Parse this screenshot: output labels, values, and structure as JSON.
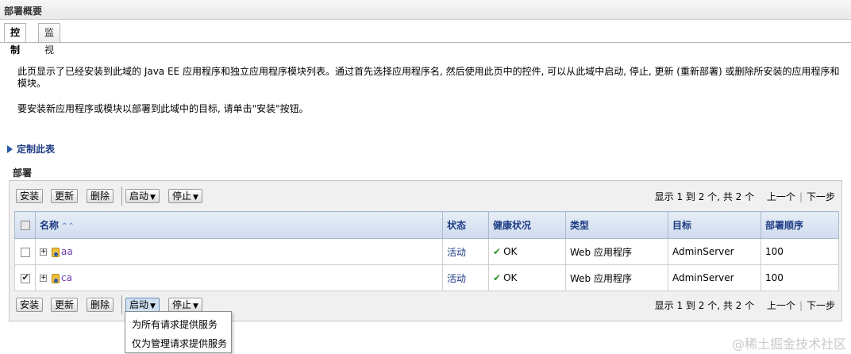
{
  "header": {
    "title": "部署概要"
  },
  "tabs": [
    {
      "label": "控制",
      "active": true
    },
    {
      "label": "监视",
      "active": false
    }
  ],
  "description": {
    "line1": "此页显示了已经安装到此域的 Java EE 应用程序和独立应用程序模块列表。通过首先选择应用程序名, 然后使用此页中的控件, 可以从此域中启动, 停止, 更新 (重新部署) 或删除所安装的应用程序和模块。",
    "line2": "要安装新应用程序或模块以部署到此域中的目标, 请单击\"安装\"按钮。"
  },
  "customize": {
    "label": "定制此表"
  },
  "section": {
    "title": "部署"
  },
  "toolbar": {
    "install": "安装",
    "update": "更新",
    "delete": "删除",
    "start": "启动",
    "stop": "停止"
  },
  "pager": {
    "summary": "显示 1 到 2 个, 共 2 个",
    "prev": "上一个",
    "next": "下一步"
  },
  "table": {
    "headers": {
      "name": "名称",
      "state": "状态",
      "health": "健康状况",
      "type": "类型",
      "target": "目标",
      "order": "部署顺序"
    },
    "rows": [
      {
        "checked": false,
        "name": "aa",
        "state": "活动",
        "health": "OK",
        "type": "Web 应用程序",
        "target": "AdminServer",
        "order": "100"
      },
      {
        "checked": true,
        "name": "ca",
        "state": "活动",
        "health": "OK",
        "type": "Web 应用程序",
        "target": "AdminServer",
        "order": "100"
      }
    ]
  },
  "start_menu": {
    "items": [
      "为所有请求提供服务",
      "仅为管理请求提供服务"
    ]
  },
  "watermark": "@稀土掘金技术社区",
  "colors": {
    "link": "#1e3c84",
    "app_link": "#6a3aa8",
    "ok": "#2d9a2d",
    "header_bg": "#cfdcee"
  }
}
